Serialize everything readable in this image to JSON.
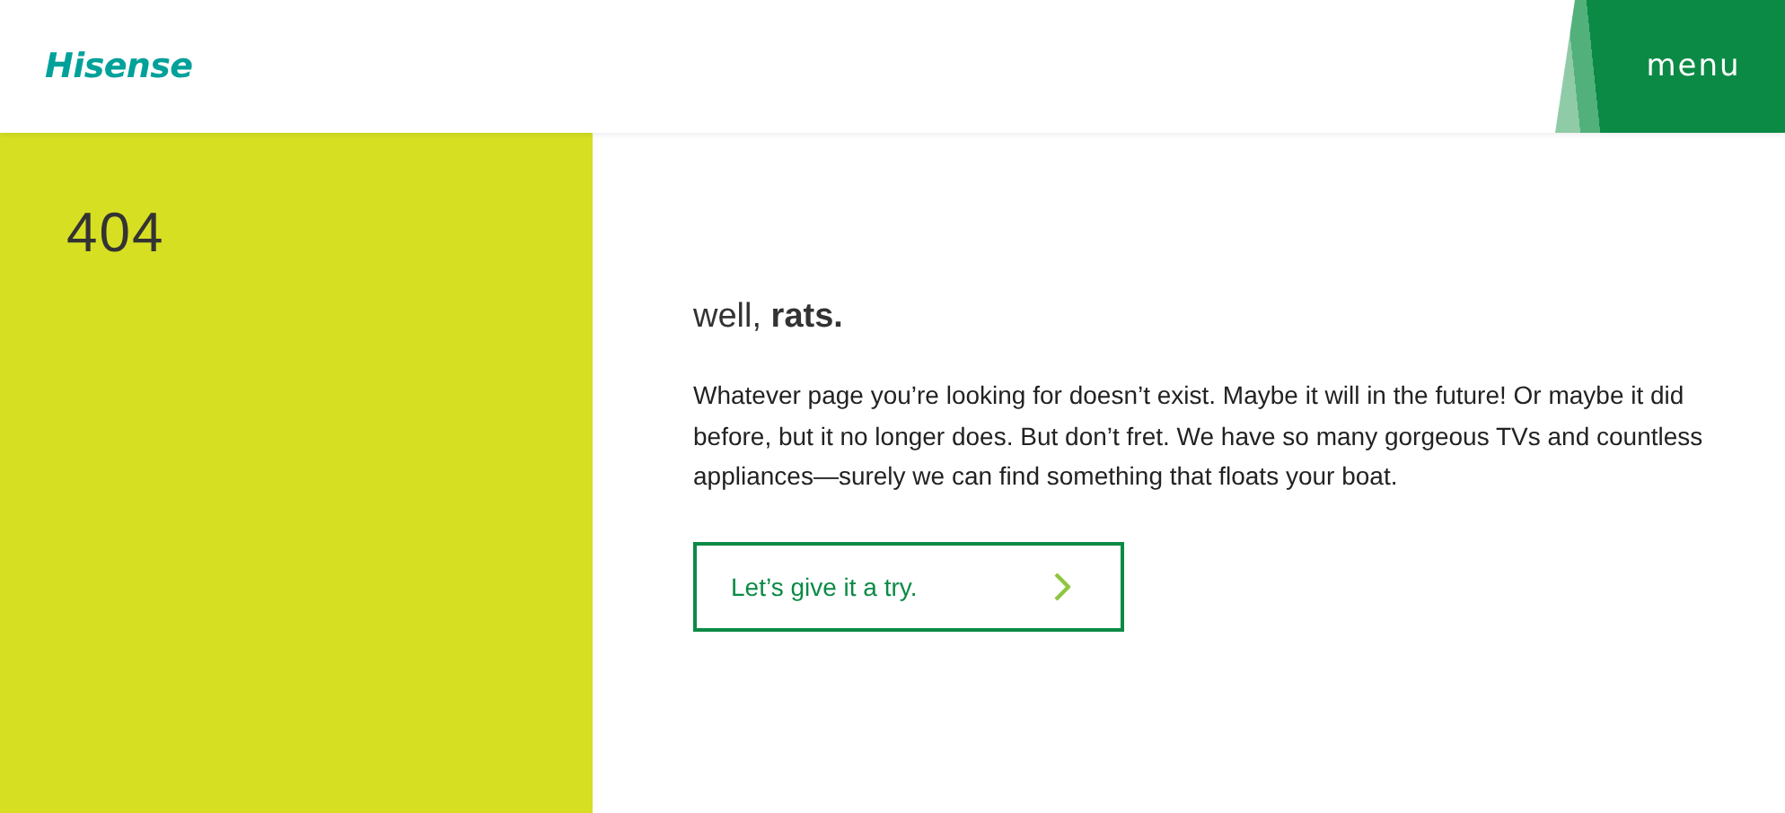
{
  "header": {
    "logo": "Hisense",
    "menu_button": "menu"
  },
  "side_panel": {
    "code": "404"
  },
  "content": {
    "heading": "well, **rats.**",
    "message": "Whatever page you’re looking for doesn’t exist. Maybe it will in the future! Or maybe it did before, but it no longer does. But don’t fret. We have so many gorgeous TVs and countless appliances—surely we can find something that floats your boat.",
    "button": "Let’s give it a try."
  }
}
